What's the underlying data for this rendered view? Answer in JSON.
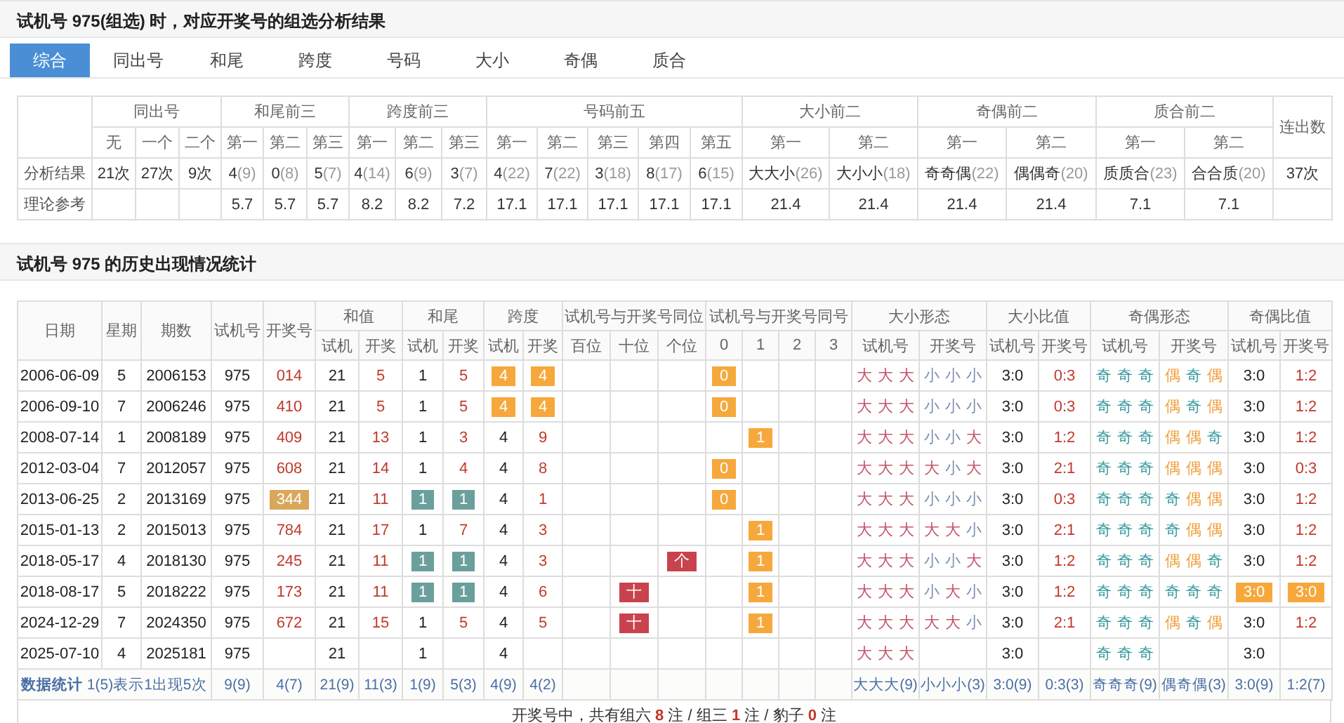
{
  "title": "试机号 975(组选) 时，对应开奖号的组选分析结果",
  "tabs": [
    {
      "label": "综合",
      "selected": true
    },
    {
      "label": "同出号",
      "selected": false
    },
    {
      "label": "和尾",
      "selected": false
    },
    {
      "label": "跨度",
      "selected": false
    },
    {
      "label": "号码",
      "selected": false
    },
    {
      "label": "大小",
      "selected": false
    },
    {
      "label": "奇偶",
      "selected": false
    },
    {
      "label": "质合",
      "selected": false
    }
  ],
  "summary": {
    "header_rows": [
      [
        {
          "rowspan": 2
        },
        {
          "label": "同出号",
          "colspan": 3
        },
        {
          "label": "和尾前三",
          "colspan": 3
        },
        {
          "label": "跨度前三",
          "colspan": 3
        },
        {
          "label": "号码前五",
          "colspan": 5
        },
        {
          "label": "大小前二",
          "colspan": 2
        },
        {
          "label": "奇偶前二",
          "colspan": 2
        },
        {
          "label": "质合前二",
          "colspan": 2
        },
        {
          "label": "连出数",
          "rowspan": 2
        }
      ],
      [
        {
          "label": "无"
        },
        {
          "label": "一个"
        },
        {
          "label": "二个"
        },
        {
          "label": "第一"
        },
        {
          "label": "第二"
        },
        {
          "label": "第三"
        },
        {
          "label": "第一"
        },
        {
          "label": "第二"
        },
        {
          "label": "第三"
        },
        {
          "label": "第一"
        },
        {
          "label": "第二"
        },
        {
          "label": "第三"
        },
        {
          "label": "第四"
        },
        {
          "label": "第五"
        },
        {
          "label": "第一"
        },
        {
          "label": "第二"
        },
        {
          "label": "第一"
        },
        {
          "label": "第二"
        },
        {
          "label": "第一"
        },
        {
          "label": "第二"
        }
      ]
    ],
    "rows": [
      {
        "label": "分析结果",
        "cells": [
          {
            "value": "21次"
          },
          {
            "value": "27次"
          },
          {
            "value": "9次"
          },
          {
            "value": "4",
            "count": "(9)"
          },
          {
            "value": "0",
            "count": "(8)"
          },
          {
            "value": "5",
            "count": "(7)"
          },
          {
            "value": "4",
            "count": "(14)"
          },
          {
            "value": "6",
            "count": "(9)"
          },
          {
            "value": "3",
            "count": "(7)"
          },
          {
            "value": "4",
            "count": "(22)"
          },
          {
            "value": "7",
            "count": "(22)"
          },
          {
            "value": "3",
            "count": "(18)"
          },
          {
            "value": "8",
            "count": "(17)"
          },
          {
            "value": "6",
            "count": "(15)"
          },
          {
            "value": "大大小",
            "count": "(26)"
          },
          {
            "value": "大小小",
            "count": "(18)"
          },
          {
            "value": "奇奇偶",
            "count": "(22)"
          },
          {
            "value": "偶偶奇",
            "count": "(20)"
          },
          {
            "value": "质质合",
            "count": "(23)"
          },
          {
            "value": "合合质",
            "count": "(20)"
          },
          {
            "value": "37次"
          }
        ]
      },
      {
        "label": "理论参考",
        "cells": [
          null,
          null,
          null,
          {
            "value": "5.7"
          },
          {
            "value": "5.7"
          },
          {
            "value": "5.7"
          },
          {
            "value": "8.2"
          },
          {
            "value": "8.2"
          },
          {
            "value": "7.2"
          },
          {
            "value": "17.1"
          },
          {
            "value": "17.1"
          },
          {
            "value": "17.1"
          },
          {
            "value": "17.1"
          },
          {
            "value": "17.1"
          },
          {
            "value": "21.4"
          },
          {
            "value": "21.4"
          },
          {
            "value": "21.4"
          },
          {
            "value": "21.4"
          },
          {
            "value": "7.1"
          },
          {
            "value": "7.1"
          },
          null
        ]
      }
    ]
  },
  "history_title": "试机号 975 的历史出现情况统计",
  "history": {
    "header_rows": [
      [
        {
          "label": "日期",
          "rowspan": 2,
          "kind": "plain"
        },
        {
          "label": "星期",
          "rowspan": 2,
          "kind": "plain"
        },
        {
          "label": "期数",
          "rowspan": 2,
          "kind": "plain"
        },
        {
          "label": "试机号",
          "rowspan": 2,
          "kind": "plain"
        },
        {
          "label": "开奖号",
          "rowspan": 2,
          "kind": "draw"
        },
        {
          "label": "和值",
          "colspan": 2
        },
        {
          "label": "和尾",
          "colspan": 2
        },
        {
          "label": "跨度",
          "colspan": 2
        },
        {
          "label": "试机号与开奖号同位",
          "colspan": 3
        },
        {
          "label": "试机号与开奖号同号",
          "colspan": 4
        },
        {
          "label": "大小形态",
          "colspan": 2
        },
        {
          "label": "大小比值",
          "colspan": 2
        },
        {
          "label": "奇偶形态",
          "colspan": 2
        },
        {
          "label": "奇偶比值",
          "colspan": 2
        }
      ],
      [
        {
          "label": "试机",
          "kind": "plain"
        },
        {
          "label": "开奖",
          "kind": "draw"
        },
        {
          "label": "试机",
          "kind": "plain"
        },
        {
          "label": "开奖",
          "kind": "draw"
        },
        {
          "label": "试机",
          "kind": "plain"
        },
        {
          "label": "开奖",
          "kind": "draw"
        },
        {
          "label": "百位",
          "kind": "plain"
        },
        {
          "label": "十位",
          "kind": "plain"
        },
        {
          "label": "个位",
          "kind": "plain"
        },
        {
          "label": "0",
          "kind": "plain"
        },
        {
          "label": "1",
          "kind": "plain"
        },
        {
          "label": "2",
          "kind": "plain"
        },
        {
          "label": "3",
          "kind": "plain"
        },
        {
          "label": "试机号",
          "kind": "plain"
        },
        {
          "label": "开奖号",
          "kind": "draw"
        },
        {
          "label": "试机号",
          "kind": "plain"
        },
        {
          "label": "开奖号",
          "kind": "draw"
        },
        {
          "label": "试机号",
          "kind": "plain"
        },
        {
          "label": "开奖号",
          "kind": "draw"
        },
        {
          "label": "试机号",
          "kind": "plain"
        },
        {
          "label": "开奖号",
          "kind": "draw"
        }
      ]
    ],
    "rows": [
      {
        "cells": [
          "2006-06-09",
          "5",
          "2006153",
          "975",
          "014",
          "21",
          "5",
          "1",
          "5",
          {
            "text": "4",
            "color": "#f6a83c"
          },
          {
            "text": "4",
            "color": "#f6a83c"
          },
          null,
          null,
          null,
          {
            "text": "0",
            "color": "#f6a83c"
          },
          null,
          null,
          null,
          [
            {
              "text": "大",
              "color": "#c4566a"
            },
            {
              "text": "大",
              "color": "#c4566a"
            },
            {
              "text": "大",
              "color": "#c4566a"
            }
          ],
          [
            {
              "text": "小",
              "color": "#7d8fb0"
            },
            {
              "text": "小",
              "color": "#7d8fb0"
            },
            {
              "text": "小",
              "color": "#7d8fb0"
            }
          ],
          "3:0",
          "0:3",
          [
            {
              "text": "奇",
              "color": "#3b9b9e"
            },
            {
              "text": "奇",
              "color": "#3b9b9e"
            },
            {
              "text": "奇",
              "color": "#3b9b9e"
            }
          ],
          [
            {
              "text": "偶",
              "color": "#ef9f3a"
            },
            {
              "text": "奇",
              "color": "#3b9b9e"
            },
            {
              "text": "偶",
              "color": "#ef9f3a"
            }
          ],
          "3:0",
          "1:2"
        ]
      },
      {
        "cells": [
          "2006-09-10",
          "7",
          "2006246",
          "975",
          "410",
          "21",
          "5",
          "1",
          "5",
          {
            "text": "4",
            "color": "#f6a83c"
          },
          {
            "text": "4",
            "color": "#f6a83c"
          },
          null,
          null,
          null,
          {
            "text": "0",
            "color": "#f6a83c"
          },
          null,
          null,
          null,
          [
            {
              "text": "大",
              "color": "#c4566a"
            },
            {
              "text": "大",
              "color": "#c4566a"
            },
            {
              "text": "大",
              "color": "#c4566a"
            }
          ],
          [
            {
              "text": "小",
              "color": "#7d8fb0"
            },
            {
              "text": "小",
              "color": "#7d8fb0"
            },
            {
              "text": "小",
              "color": "#7d8fb0"
            }
          ],
          "3:0",
          "0:3",
          [
            {
              "text": "奇",
              "color": "#3b9b9e"
            },
            {
              "text": "奇",
              "color": "#3b9b9e"
            },
            {
              "text": "奇",
              "color": "#3b9b9e"
            }
          ],
          [
            {
              "text": "偶",
              "color": "#ef9f3a"
            },
            {
              "text": "奇",
              "color": "#3b9b9e"
            },
            {
              "text": "偶",
              "color": "#ef9f3a"
            }
          ],
          "3:0",
          "1:2"
        ]
      },
      {
        "cells": [
          "2008-07-14",
          "1",
          "2008189",
          "975",
          "409",
          "21",
          "13",
          "1",
          "3",
          "4",
          "9",
          null,
          null,
          null,
          null,
          {
            "text": "1",
            "color": "#f6a83c"
          },
          null,
          null,
          [
            {
              "text": "大",
              "color": "#c4566a"
            },
            {
              "text": "大",
              "color": "#c4566a"
            },
            {
              "text": "大",
              "color": "#c4566a"
            }
          ],
          [
            {
              "text": "小",
              "color": "#7d8fb0"
            },
            {
              "text": "小",
              "color": "#7d8fb0"
            },
            {
              "text": "大",
              "color": "#c4566a"
            }
          ],
          "3:0",
          "1:2",
          [
            {
              "text": "奇",
              "color": "#3b9b9e"
            },
            {
              "text": "奇",
              "color": "#3b9b9e"
            },
            {
              "text": "奇",
              "color": "#3b9b9e"
            }
          ],
          [
            {
              "text": "偶",
              "color": "#ef9f3a"
            },
            {
              "text": "偶",
              "color": "#ef9f3a"
            },
            {
              "text": "奇",
              "color": "#3b9b9e"
            }
          ],
          "3:0",
          "1:2"
        ]
      },
      {
        "cells": [
          "2012-03-04",
          "7",
          "2012057",
          "975",
          "608",
          "21",
          "14",
          "1",
          "4",
          "4",
          "8",
          null,
          null,
          null,
          {
            "text": "0",
            "color": "#f6a83c"
          },
          null,
          null,
          null,
          [
            {
              "text": "大",
              "color": "#c4566a"
            },
            {
              "text": "大",
              "color": "#c4566a"
            },
            {
              "text": "大",
              "color": "#c4566a"
            }
          ],
          [
            {
              "text": "大",
              "color": "#c4566a"
            },
            {
              "text": "小",
              "color": "#7d8fb0"
            },
            {
              "text": "大",
              "color": "#c4566a"
            }
          ],
          "3:0",
          "2:1",
          [
            {
              "text": "奇",
              "color": "#3b9b9e"
            },
            {
              "text": "奇",
              "color": "#3b9b9e"
            },
            {
              "text": "奇",
              "color": "#3b9b9e"
            }
          ],
          [
            {
              "text": "偶",
              "color": "#ef9f3a"
            },
            {
              "text": "偶",
              "color": "#ef9f3a"
            },
            {
              "text": "偶",
              "color": "#ef9f3a"
            }
          ],
          "3:0",
          "0:3"
        ]
      },
      {
        "cells": [
          "2013-06-25",
          "2",
          "2013169",
          "975",
          {
            "text": "344",
            "color": "#d9a75a"
          },
          "21",
          "11",
          {
            "text": "1",
            "color": "#6a9f9c"
          },
          {
            "text": "1",
            "color": "#6a9f9c"
          },
          "4",
          "1",
          null,
          null,
          null,
          {
            "text": "0",
            "color": "#f6a83c"
          },
          null,
          null,
          null,
          [
            {
              "text": "大",
              "color": "#c4566a"
            },
            {
              "text": "大",
              "color": "#c4566a"
            },
            {
              "text": "大",
              "color": "#c4566a"
            }
          ],
          [
            {
              "text": "小",
              "color": "#7d8fb0"
            },
            {
              "text": "小",
              "color": "#7d8fb0"
            },
            {
              "text": "小",
              "color": "#7d8fb0"
            }
          ],
          "3:0",
          "0:3",
          [
            {
              "text": "奇",
              "color": "#3b9b9e"
            },
            {
              "text": "奇",
              "color": "#3b9b9e"
            },
            {
              "text": "奇",
              "color": "#3b9b9e"
            }
          ],
          [
            {
              "text": "奇",
              "color": "#3b9b9e"
            },
            {
              "text": "偶",
              "color": "#ef9f3a"
            },
            {
              "text": "偶",
              "color": "#ef9f3a"
            }
          ],
          "3:0",
          "1:2"
        ]
      },
      {
        "cells": [
          "2015-01-13",
          "2",
          "2015013",
          "975",
          "784",
          "21",
          "17",
          "1",
          "7",
          "4",
          "3",
          null,
          null,
          null,
          null,
          {
            "text": "1",
            "color": "#f6a83c"
          },
          null,
          null,
          [
            {
              "text": "大",
              "color": "#c4566a"
            },
            {
              "text": "大",
              "color": "#c4566a"
            },
            {
              "text": "大",
              "color": "#c4566a"
            }
          ],
          [
            {
              "text": "大",
              "color": "#c4566a"
            },
            {
              "text": "大",
              "color": "#c4566a"
            },
            {
              "text": "小",
              "color": "#7d8fb0"
            }
          ],
          "3:0",
          "2:1",
          [
            {
              "text": "奇",
              "color": "#3b9b9e"
            },
            {
              "text": "奇",
              "color": "#3b9b9e"
            },
            {
              "text": "奇",
              "color": "#3b9b9e"
            }
          ],
          [
            {
              "text": "奇",
              "color": "#3b9b9e"
            },
            {
              "text": "偶",
              "color": "#ef9f3a"
            },
            {
              "text": "偶",
              "color": "#ef9f3a"
            }
          ],
          "3:0",
          "1:2"
        ]
      },
      {
        "cells": [
          "2018-05-17",
          "4",
          "2018130",
          "975",
          "245",
          "21",
          "11",
          {
            "text": "1",
            "color": "#6a9f9c"
          },
          {
            "text": "1",
            "color": "#6a9f9c"
          },
          "4",
          "3",
          null,
          null,
          {
            "text": "个",
            "color": "#c9434f"
          },
          null,
          {
            "text": "1",
            "color": "#f6a83c"
          },
          null,
          null,
          [
            {
              "text": "大",
              "color": "#c4566a"
            },
            {
              "text": "大",
              "color": "#c4566a"
            },
            {
              "text": "大",
              "color": "#c4566a"
            }
          ],
          [
            {
              "text": "小",
              "color": "#7d8fb0"
            },
            {
              "text": "小",
              "color": "#7d8fb0"
            },
            {
              "text": "大",
              "color": "#c4566a"
            }
          ],
          "3:0",
          "1:2",
          [
            {
              "text": "奇",
              "color": "#3b9b9e"
            },
            {
              "text": "奇",
              "color": "#3b9b9e"
            },
            {
              "text": "奇",
              "color": "#3b9b9e"
            }
          ],
          [
            {
              "text": "偶",
              "color": "#ef9f3a"
            },
            {
              "text": "偶",
              "color": "#ef9f3a"
            },
            {
              "text": "奇",
              "color": "#3b9b9e"
            }
          ],
          "3:0",
          "1:2"
        ]
      },
      {
        "cells": [
          "2018-08-17",
          "5",
          "2018222",
          "975",
          "173",
          "21",
          "11",
          {
            "text": "1",
            "color": "#6a9f9c"
          },
          {
            "text": "1",
            "color": "#6a9f9c"
          },
          "4",
          "6",
          null,
          {
            "text": "十",
            "color": "#c9434f"
          },
          null,
          null,
          {
            "text": "1",
            "color": "#f6a83c"
          },
          null,
          null,
          [
            {
              "text": "大",
              "color": "#c4566a"
            },
            {
              "text": "大",
              "color": "#c4566a"
            },
            {
              "text": "大",
              "color": "#c4566a"
            }
          ],
          [
            {
              "text": "小",
              "color": "#7d8fb0"
            },
            {
              "text": "大",
              "color": "#c4566a"
            },
            {
              "text": "小",
              "color": "#7d8fb0"
            }
          ],
          "3:0",
          "1:2",
          [
            {
              "text": "奇",
              "color": "#3b9b9e"
            },
            {
              "text": "奇",
              "color": "#3b9b9e"
            },
            {
              "text": "奇",
              "color": "#3b9b9e"
            }
          ],
          [
            {
              "text": "奇",
              "color": "#3b9b9e"
            },
            {
              "text": "奇",
              "color": "#3b9b9e"
            },
            {
              "text": "奇",
              "color": "#3b9b9e"
            }
          ],
          {
            "text": "3:0",
            "color": "#f6a83c"
          },
          {
            "text": "3:0",
            "color": "#f6a83c"
          }
        ]
      },
      {
        "cells": [
          "2024-12-29",
          "7",
          "2024350",
          "975",
          "672",
          "21",
          "15",
          "1",
          "5",
          "4",
          "5",
          null,
          {
            "text": "十",
            "color": "#c9434f"
          },
          null,
          null,
          {
            "text": "1",
            "color": "#f6a83c"
          },
          null,
          null,
          [
            {
              "text": "大",
              "color": "#c4566a"
            },
            {
              "text": "大",
              "color": "#c4566a"
            },
            {
              "text": "大",
              "color": "#c4566a"
            }
          ],
          [
            {
              "text": "大",
              "color": "#c4566a"
            },
            {
              "text": "大",
              "color": "#c4566a"
            },
            {
              "text": "小",
              "color": "#7d8fb0"
            }
          ],
          "3:0",
          "2:1",
          [
            {
              "text": "奇",
              "color": "#3b9b9e"
            },
            {
              "text": "奇",
              "color": "#3b9b9e"
            },
            {
              "text": "奇",
              "color": "#3b9b9e"
            }
          ],
          [
            {
              "text": "偶",
              "color": "#ef9f3a"
            },
            {
              "text": "奇",
              "color": "#3b9b9e"
            },
            {
              "text": "偶",
              "color": "#ef9f3a"
            }
          ],
          "3:0",
          "1:2"
        ]
      },
      {
        "cells": [
          "2025-07-10",
          "4",
          "2025181",
          "975",
          null,
          "21",
          null,
          "1",
          null,
          "4",
          null,
          null,
          null,
          null,
          null,
          null,
          null,
          null,
          [
            {
              "text": "大",
              "color": "#c4566a"
            },
            {
              "text": "大",
              "color": "#c4566a"
            },
            {
              "text": "大",
              "color": "#c4566a"
            }
          ],
          null,
          "3:0",
          null,
          [
            {
              "text": "奇",
              "color": "#3b9b9e"
            },
            {
              "text": "奇",
              "color": "#3b9b9e"
            },
            {
              "text": "奇",
              "color": "#3b9b9e"
            }
          ],
          null,
          "3:0",
          null
        ]
      }
    ],
    "footer": {
      "label": "数据统计",
      "note": "1(5)表示1出现5次",
      "cells": [
        "9(9)",
        "4(7)",
        "21(9)",
        "11(3)",
        "1(9)",
        "5(3)",
        "4(9)",
        "4(2)",
        null,
        null,
        null,
        null,
        null,
        null,
        null,
        "大大大(9)",
        "小小小(3)",
        "3:0(9)",
        "0:3(3)",
        "奇奇奇(9)",
        "偶奇偶(3)",
        "3:0(9)",
        "1:2(7)"
      ]
    },
    "result_line": "开奖号中，共有组六 **8** 注 / 组三 **1** 注 / 豹子 **0** 注"
  }
}
